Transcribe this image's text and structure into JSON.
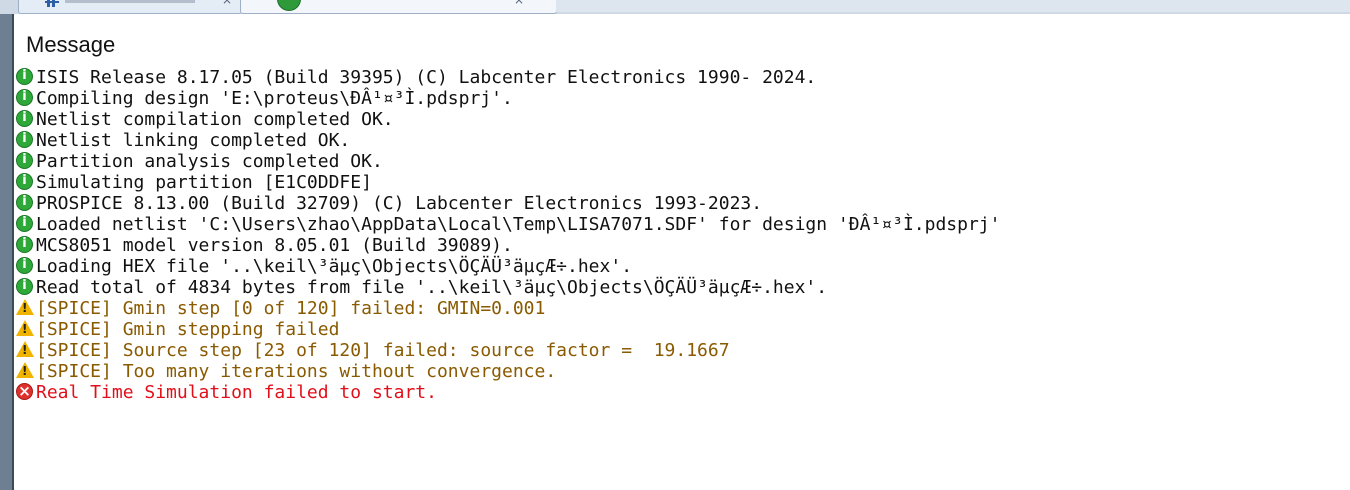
{
  "colors": {
    "info_text": "#111111",
    "warning_text": "#8a5a00",
    "error_text": "#e0101a",
    "info_icon": "#2fa83a",
    "warning_icon": "#f0b400",
    "error_icon": "#e0302c"
  },
  "tabs": [
    {
      "icon": "schematic-icon",
      "close": "×"
    },
    {
      "icon": "source-code-icon",
      "close": "×"
    }
  ],
  "panel": {
    "title": "Message"
  },
  "messages": [
    {
      "type": "info",
      "icon": "info-icon",
      "text": "ISIS Release 8.17.05 (Build 39395) (C) Labcenter Electronics 1990- 2024."
    },
    {
      "type": "info",
      "icon": "info-icon",
      "text": "Compiling design 'E:\\proteus\\ÐÂ¹¤³Ì.pdsprj'."
    },
    {
      "type": "info",
      "icon": "info-icon",
      "text": "Netlist compilation completed OK."
    },
    {
      "type": "info",
      "icon": "info-icon",
      "text": "Netlist linking completed OK."
    },
    {
      "type": "info",
      "icon": "info-icon",
      "text": "Partition analysis completed OK."
    },
    {
      "type": "info",
      "icon": "info-icon",
      "text": "Simulating partition [E1C0DDFE]"
    },
    {
      "type": "info",
      "icon": "info-icon",
      "text": "PROSPICE 8.13.00 (Build 32709) (C) Labcenter Electronics 1993-2023."
    },
    {
      "type": "info",
      "icon": "info-icon",
      "text": "Loaded netlist 'C:\\Users\\zhao\\AppData\\Local\\Temp\\LISA7071.SDF' for design 'ÐÂ¹¤³Ì.pdsprj'"
    },
    {
      "type": "info",
      "icon": "info-icon",
      "text": "MCS8051 model version 8.05.01 (Build 39089)."
    },
    {
      "type": "info",
      "icon": "info-icon",
      "text": "Loading HEX file '..\\keil\\³äµç\\Objects\\ÖÇÄÜ³äµçÆ÷.hex'."
    },
    {
      "type": "info",
      "icon": "info-icon",
      "text": "Read total of 4834 bytes from file '..\\keil\\³äµç\\Objects\\ÖÇÄÜ³äµçÆ÷.hex'."
    },
    {
      "type": "warning",
      "icon": "warning-icon",
      "text": "[SPICE] Gmin step [0 of 120] failed: GMIN=0.001"
    },
    {
      "type": "warning",
      "icon": "warning-icon",
      "text": "[SPICE] Gmin stepping failed"
    },
    {
      "type": "warning",
      "icon": "warning-icon",
      "text": "[SPICE] Source step [23 of 120] failed: source factor =  19.1667"
    },
    {
      "type": "warning",
      "icon": "warning-icon",
      "text": "[SPICE] Too many iterations without convergence."
    },
    {
      "type": "error",
      "icon": "error-icon",
      "text": "Real Time Simulation failed to start."
    }
  ]
}
